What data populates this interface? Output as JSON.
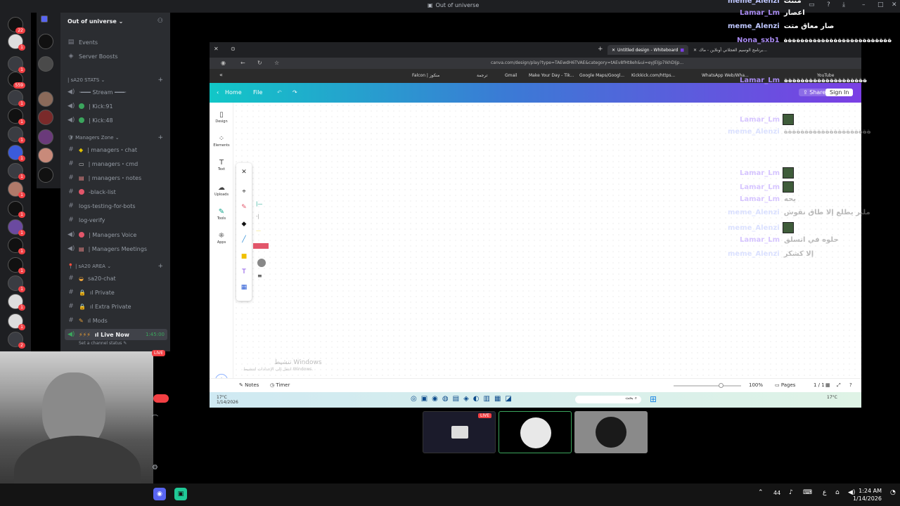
{
  "window": {
    "title": "Out of universe"
  },
  "server": {
    "name": "Out of universe"
  },
  "rail": {
    "badges": [
      "22",
      "1",
      "1",
      "559",
      "1",
      "1",
      "1",
      "1",
      "1",
      "1",
      "1",
      "1",
      "1",
      "1",
      "1",
      "1",
      "1",
      "2"
    ]
  },
  "channels": {
    "events": "Events",
    "boosts": "Server Boosts",
    "cat1": "| sA20 STATS",
    "stream": "·━━━ Stream ━━━·",
    "kick91": "| Kick:91",
    "kick48": "| Kick:48",
    "cat2": "Managers Zone",
    "mchat": "| managers・chat",
    "mcmd": "| managers・cmd",
    "mnotes": "| managers・notes",
    "blacklist": "-black-list",
    "logs": "logs-testing-for-bots",
    "logverify": "log-verify",
    "mvoice": "| Managers Voice",
    "mmeet": "| Managers Meetings",
    "cat3": "| sA20 AREA",
    "sachat": "sa20-chat",
    "private": "ıl Private",
    "extra": "ıl Extra Private",
    "mods": "ıl Mods",
    "live": "ıl Live Now",
    "live_time": "1:45:00",
    "status": "Set a channel status"
  },
  "cam": {
    "live": "LIVE"
  },
  "browser": {
    "tab_active": "Untitled design - Whiteboard",
    "tab2": "برنامج الوسيم العجلاني أونلاين - ماك...",
    "url": "canva.com/design/play?type=TAEwdH6TVAE&category=tAEv8fHt8eh&ui=eyJEIjp7IkhDIjp...",
    "bookmarks": [
      "Falcon | منكوز",
      "ترجمة",
      "Gmail",
      "Make Your Day - Tik...",
      "Google Maps/Googl...",
      "Kickkick.com/https...",
      "WhatsApp Web/Wha...",
      "YouTube"
    ]
  },
  "canva": {
    "home": "Home",
    "file": "File",
    "share": "Share",
    "signin": "Sign In",
    "sidebar": [
      "Design",
      "Elements",
      "Text",
      "Uploads",
      "Tools",
      "Apps"
    ],
    "notes": "Notes",
    "timer": "Timer",
    "zoom": "100%",
    "pages": "Pages",
    "page_count": "1 / 1",
    "watermark1": "تنشيط Windows",
    "watermark2": "انتقل إلى الإعدادات لتنشيط Windows."
  },
  "wintask": {
    "weather": "17°C",
    "date": "1/14/2026",
    "search": "بحث"
  },
  "chat": [
    {
      "user": "meme_Alenzi",
      "text": "منتت",
      "faded": false
    },
    {
      "user": "Lamar_Lm",
      "text": "اعصار",
      "faded": false
    },
    {
      "user": "meme_Alenzi",
      "text": "صار معاق متت",
      "faded": false
    },
    {
      "user": "Nona_sxb1",
      "text": "ةةةةةةةةةةةةةةةةةةةةةةةةةة",
      "faded": false
    },
    {
      "user": "Lamar_Lm",
      "text": "ةةةةةةةةةةةةةةةةةةةة",
      "faded": false
    },
    {
      "user": "Lamar_Lm",
      "text": "",
      "faded": true
    },
    {
      "user": "meme_Alenzi",
      "text": "ةةةةةةةةةةةةةةةةةةةةة",
      "faded": true
    },
    {
      "user": "Lamar_Lm",
      "text": "",
      "faded": true
    },
    {
      "user": "Lamar_Lm",
      "text": "",
      "faded": true
    },
    {
      "user": "Lamar_Lm",
      "text": "يحه",
      "faded": true
    },
    {
      "user": "meme_Alenzi",
      "text": "ملبر يطلع إلا طاق نقوش",
      "faded": true
    },
    {
      "user": "meme_Alenzi",
      "text": "",
      "faded": true
    },
    {
      "user": "Lamar_Lm",
      "text": "حلوه في اتسلق",
      "faded": true
    },
    {
      "user": "meme_Alenzi",
      "text": "إلا كشكر",
      "faded": true
    }
  ],
  "tiles": {
    "live": "LIVE"
  },
  "taskbar": {
    "time": "1:24 AM",
    "date": "1/14/2026",
    "num": "44"
  }
}
